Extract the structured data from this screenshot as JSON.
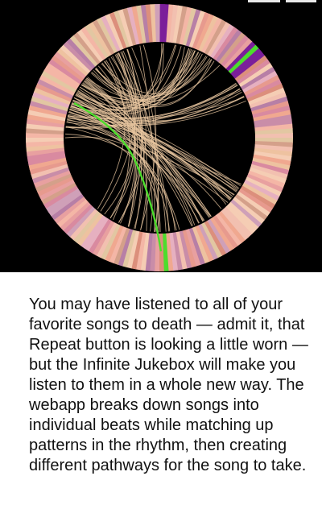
{
  "visualization": {
    "name": "Infinite Jukebox beat circle",
    "background": "#000000",
    "segment_colors": [
      "#e8a0a0",
      "#f4b6a6",
      "#d98aa0",
      "#f2c0b0",
      "#e79a8e",
      "#c98da8",
      "#f5cdb4",
      "#d4a08a",
      "#b77fa6",
      "#eec2a0",
      "#e6b0c0",
      "#f0a890",
      "#cfa0b8",
      "#e2c7a2",
      "#dc8f7c"
    ],
    "accent_colors": {
      "purple": "#7b1f9a",
      "green": "#4cdd2c",
      "chord": "#e9c7a0"
    }
  },
  "article": {
    "paragraph": "You may have listened to all of your favorite songs to death — admit it, that Repeat button is looking a little worn — but the Infinite Jukebox will make you listen to them in a whole new way. The webapp breaks down songs into individual beats while matching up patterns in the rhythm, then creating different pathways for the song to take."
  }
}
